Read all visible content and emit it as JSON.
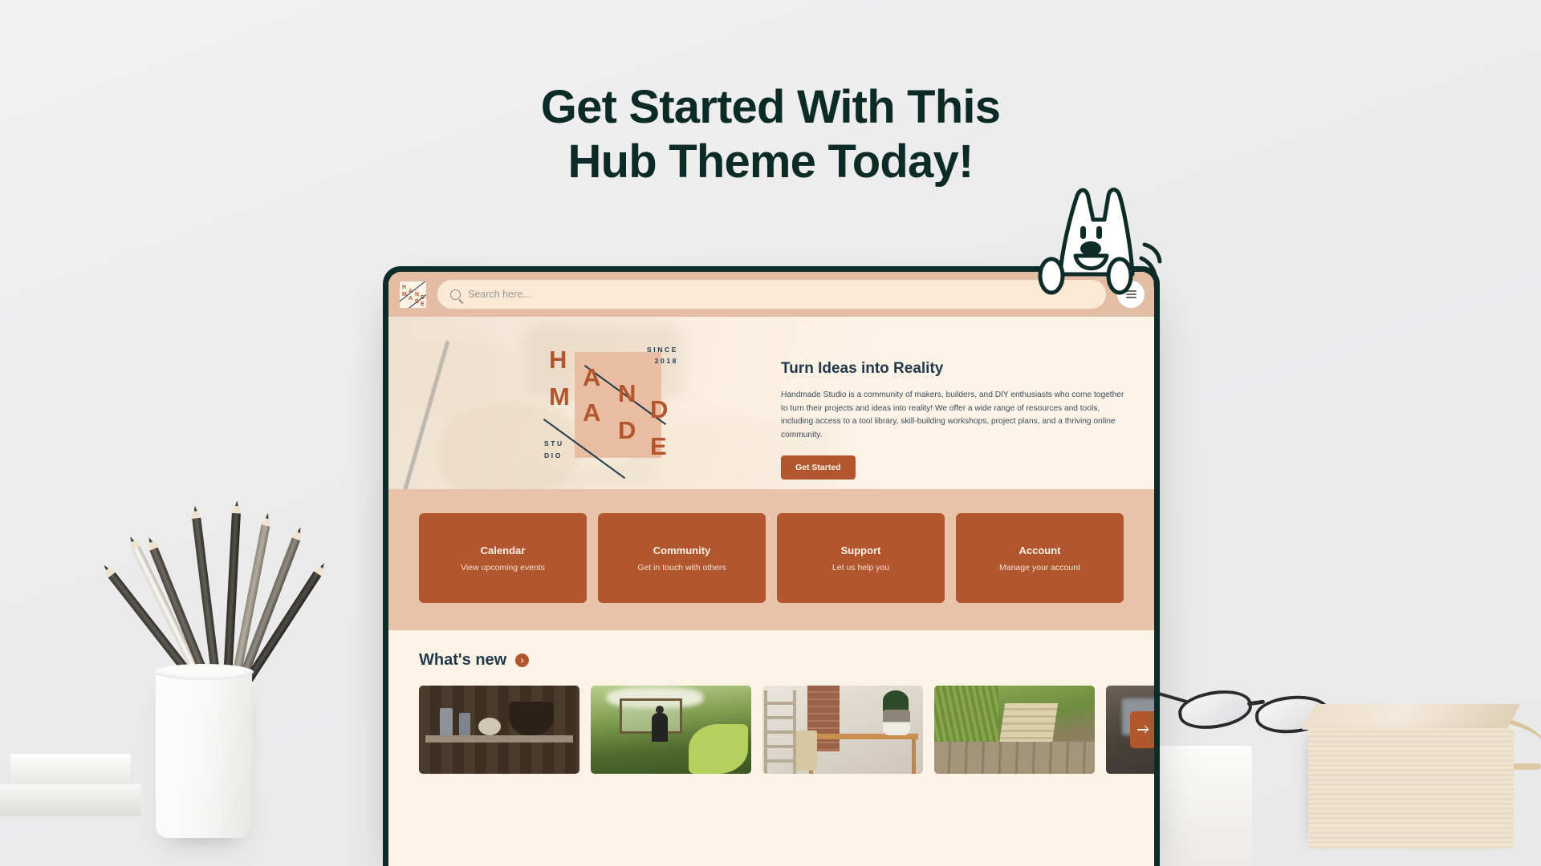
{
  "headline": {
    "line1": "Get Started With This",
    "line2": "Hub Theme Today!",
    "color": "#0c2b26"
  },
  "colors": {
    "page_background": "#eeeeef",
    "device_bezel": "#0d2b28",
    "navbar": "#e3bda4",
    "terracotta": "#b1562f",
    "cream": "#fdf3e6",
    "peach_band": "#e8c4ab",
    "navy_text": "#22394d"
  },
  "browser": {
    "navbar": {
      "logo": {
        "name": "handmade-studio-logo",
        "letters_left": [
          "H",
          "M"
        ],
        "letters_mid": [
          "A",
          "A"
        ],
        "letters_mid2": [
          "N",
          "D"
        ],
        "letters_right": [
          "D",
          "E"
        ]
      },
      "search": {
        "icon": "search-icon",
        "placeholder": "Search here...",
        "value": ""
      },
      "menu_button": {
        "icon": "hamburger-menu-icon",
        "label": "Menu"
      }
    },
    "hero": {
      "brandmark": {
        "since_line1": "SINCE",
        "since_line2": "2018",
        "studio_line1": "STU",
        "studio_line2": "DIO",
        "big_letters": [
          "H",
          "A",
          "N",
          "D",
          "M",
          "A",
          "D",
          "E"
        ]
      },
      "title": "Turn Ideas into Reality",
      "body": "Handmade Studio is a community of makers, builders, and DIY enthusiasts who come together to turn their projects and ideas into reality! We offer a wide range of resources and tools, including access to a tool library, skill-building workshops, project plans, and a thriving online community.",
      "cta_label": "Get Started"
    },
    "quick_links": [
      {
        "title": "Calendar",
        "subtitle": "View upcoming events"
      },
      {
        "title": "Community",
        "subtitle": "Get in touch with others"
      },
      {
        "title": "Support",
        "subtitle": "Let us help you"
      },
      {
        "title": "Account",
        "subtitle": "Manage your account"
      }
    ],
    "whats_new": {
      "heading": "What's new",
      "badge_icon": "chevron-right-circle-icon",
      "next_button_icon": "arrow-right-icon",
      "thumbnails": [
        {
          "alt": "rustic shelf with metal urn and canisters on wood wall"
        },
        {
          "alt": "man working in a lush garden nursery"
        },
        {
          "alt": "wooden workbench and ladder against brick wall"
        },
        {
          "alt": "pallet chair on a wooden deck by the grass"
        },
        {
          "alt": "dim workshop interior"
        }
      ]
    }
  },
  "mascot": {
    "name": "bunny-mascot",
    "alt": "white rabbit peeking over the laptop"
  },
  "desk_props": [
    {
      "name": "pencil-cup",
      "alt": "white ceramic cup holding graphite pencils"
    },
    {
      "name": "book-stack",
      "alt": "stacked white books"
    },
    {
      "name": "eyeglasses",
      "alt": "pair of eyeglasses"
    },
    {
      "name": "wood-block",
      "alt": "light wooden block"
    }
  ]
}
